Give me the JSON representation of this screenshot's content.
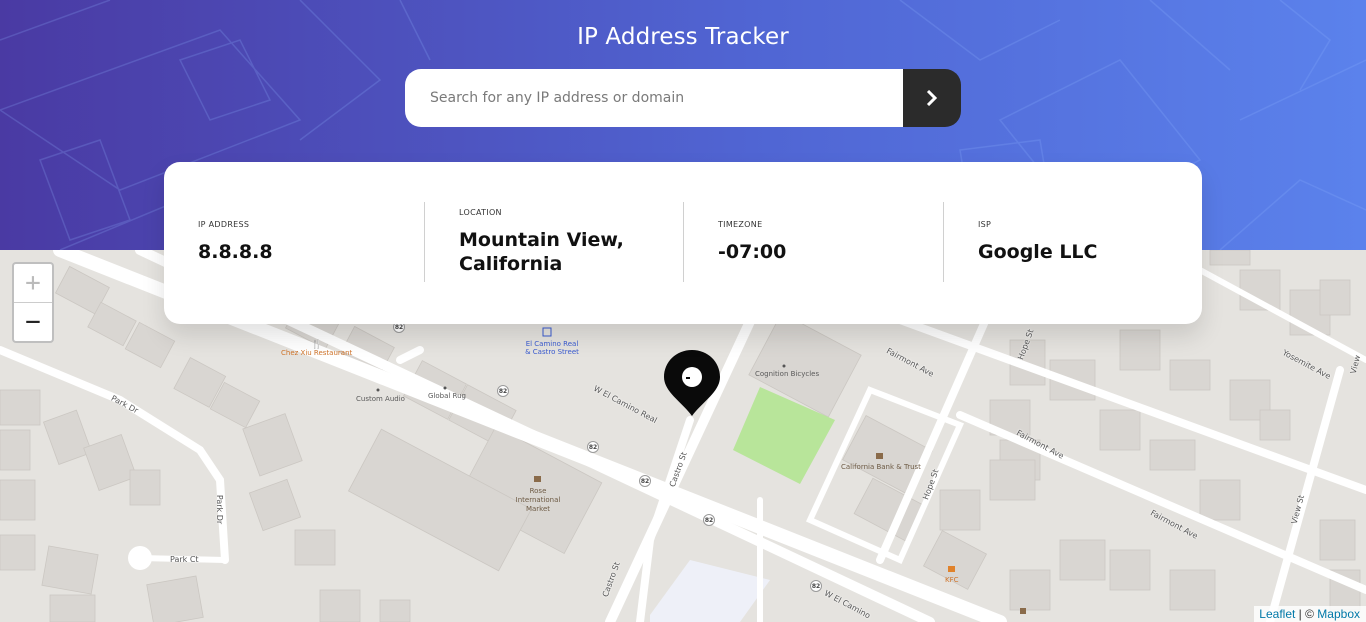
{
  "header": {
    "title": "IP Address Tracker",
    "search": {
      "placeholder": "Search for any IP address or domain",
      "value": ""
    },
    "submit_icon": "chevron-right-icon"
  },
  "info": {
    "ip": {
      "label": "IP ADDRESS",
      "value": "8.8.8.8"
    },
    "location": {
      "label": "LOCATION",
      "value_line1": "Mountain View,",
      "value_line2": "California"
    },
    "timezone": {
      "label": "TIMEZONE",
      "value": "-07:00"
    },
    "isp": {
      "label": "ISP",
      "value": "Google LLC"
    }
  },
  "map": {
    "zoom_in": "+",
    "zoom_out": "−",
    "attribution": {
      "leaflet": "Leaflet",
      "sep": " | © ",
      "mapbox": "Mapbox"
    },
    "pois": {
      "chez_xiu": "Chez Xiu Restaurant",
      "el_camino_station": "El Camino Real & Castro Street",
      "cognition": "Cognition Bicycles",
      "custom_audio": "Custom Audio",
      "global_rug": "Global Rug",
      "california_bank": "California Bank & Trust",
      "rose_market": "Rose International Market",
      "kfc": "KFC"
    },
    "streets": {
      "w_el_camino_1": "W El Camino Real",
      "w_el_camino_2": "W El Camino",
      "castro_1": "Castro St",
      "castro_2": "Castro St",
      "park_dr_1": "Park Dr",
      "park_dr_2": "Park Dr",
      "park_ct": "Park Ct",
      "fairmont_1": "Fairmont Ave",
      "fairmont_2": "Fairmont Ave",
      "fairmont_3": "Fairmont Ave",
      "hope_1": "Hope St",
      "hope_2": "Hope St",
      "yosemite": "Yosemite Ave",
      "view_1": "View St",
      "view_2": "View"
    },
    "route_shield": "82",
    "colors": {
      "accent": "#5065d3",
      "park": "#b8e59a",
      "road": "#ffffff",
      "building": "#d9d6d2"
    }
  }
}
